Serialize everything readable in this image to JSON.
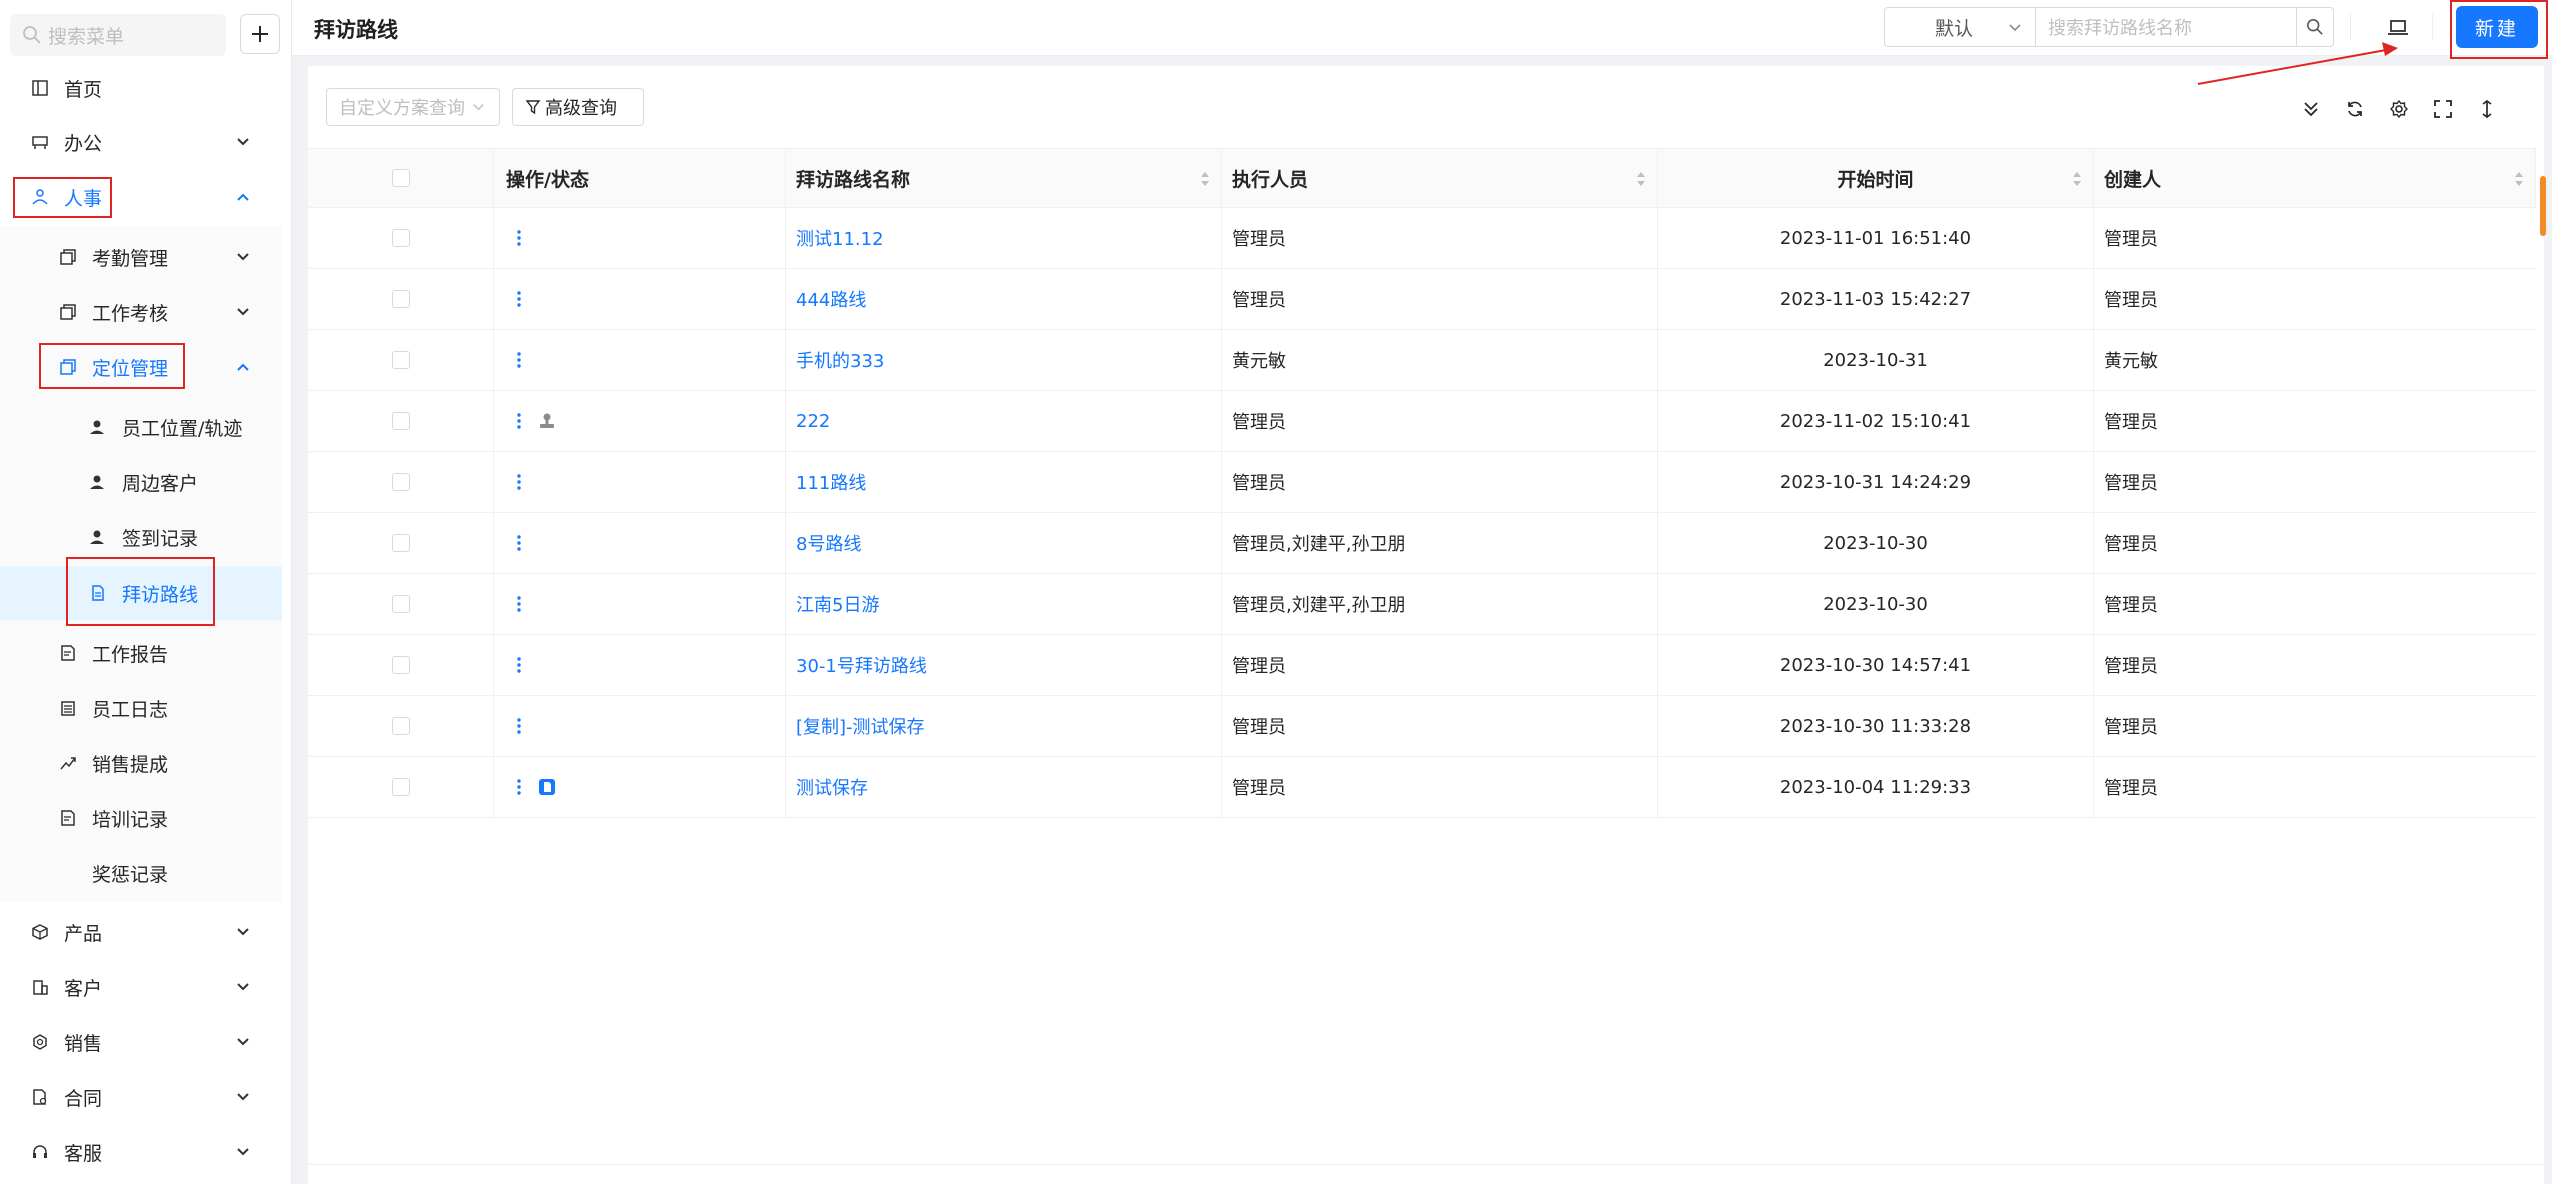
{
  "sidebar": {
    "search_placeholder": "搜索菜单",
    "items": {
      "home": "首页",
      "office": "办公",
      "hr": "人事",
      "attendance": "考勤管理",
      "appraisal": "工作考核",
      "location": "定位管理",
      "emp_position": "员工位置/轨迹",
      "nearby": "周边客户",
      "checkin": "签到记录",
      "visit_route": "拜访路线",
      "work_report": "工作报告",
      "emp_log": "员工日志",
      "sales_commission": "销售提成",
      "training": "培训记录",
      "reward": "奖惩记录",
      "product": "产品",
      "customer": "客户",
      "sales": "销售",
      "contract": "合同",
      "service": "客服"
    }
  },
  "header": {
    "title": "拜访路线",
    "view_select": "默认",
    "search_placeholder": "搜索拜访路线名称",
    "new_button": "新建"
  },
  "toolbar": {
    "custom_query": "自定义方案查询",
    "advanced_query": "高级查询"
  },
  "table": {
    "columns": {
      "op": "操作/状态",
      "name": "拜访路线名称",
      "exec": "执行人员",
      "time": "开始时间",
      "creator": "创建人"
    },
    "rows": [
      {
        "name": "测试11.12",
        "exec": "管理员",
        "time": "2023-11-01 16:51:40",
        "creator": "管理员",
        "status_icon": ""
      },
      {
        "name": "444路线",
        "exec": "管理员",
        "time": "2023-11-03 15:42:27",
        "creator": "管理员",
        "status_icon": ""
      },
      {
        "name": "手机的333",
        "exec": "黄元敏",
        "time": "2023-10-31",
        "creator": "黄元敏",
        "status_icon": ""
      },
      {
        "name": "222",
        "exec": "管理员",
        "time": "2023-11-02 15:10:41",
        "creator": "管理员",
        "status_icon": "stamp-icon"
      },
      {
        "name": "111路线",
        "exec": "管理员",
        "time": "2023-10-31 14:24:29",
        "creator": "管理员",
        "status_icon": ""
      },
      {
        "name": "8号路线",
        "exec": "管理员,刘建平,孙卫朋",
        "time": "2023-10-30",
        "creator": "管理员",
        "status_icon": ""
      },
      {
        "name": "江南5日游",
        "exec": "管理员,刘建平,孙卫朋",
        "time": "2023-10-30",
        "creator": "管理员",
        "status_icon": ""
      },
      {
        "name": "30-1号拜访路线",
        "exec": "管理员",
        "time": "2023-10-30 14:57:41",
        "creator": "管理员",
        "status_icon": ""
      },
      {
        "name": "[复制]-测试保存",
        "exec": "管理员",
        "time": "2023-10-30 11:33:28",
        "creator": "管理员",
        "status_icon": ""
      },
      {
        "name": "测试保存",
        "exec": "管理员",
        "time": "2023-10-04 11:29:33",
        "creator": "管理员",
        "status_icon": "draft-icon"
      }
    ]
  },
  "colors": {
    "accent": "#1677ff",
    "annotation_red": "#e02424"
  }
}
